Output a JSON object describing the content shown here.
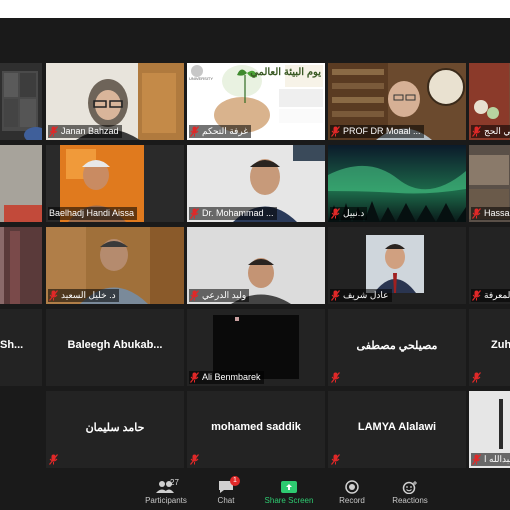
{
  "colors": {
    "active_speaker": "#c9e830",
    "share_green": "#2ecc71",
    "muted_red": "#e02828",
    "tile_bg": "#232323"
  },
  "tiles": {
    "r1c1": {
      "name": ""
    },
    "r1c2": {
      "name": "Janan Bahzad"
    },
    "r1c3": {
      "name": "غرفة التحكم",
      "poster_title": "يوم البيئة العالمي",
      "poster_subtitle": "UNIVERSITY"
    },
    "r1c4": {
      "name": "PROF DR Moaal ..."
    },
    "r1c5": {
      "name": "علي الحج"
    },
    "r2c1": {
      "name": ""
    },
    "r2c2": {
      "name": "Baelhadj Handi Aissa"
    },
    "r2c3": {
      "name": "Dr. Mohammad ..."
    },
    "r2c4": {
      "name": "د.نبيل"
    },
    "r2c5": {
      "name": "Hassan"
    },
    "r3c1": {
      "name": ""
    },
    "r3c2": {
      "name": "د. خليل السعيد"
    },
    "r3c3": {
      "name": "وليد الدرعي"
    },
    "r3c4": {
      "name": "عادل شريف"
    },
    "r3c5": {
      "name": "المعرفة"
    },
    "r4c1": {
      "center": "Sh..."
    },
    "r4c2": {
      "center": "Baleegh  Abukab..."
    },
    "r4c3": {
      "name": "Ali Benmbarek"
    },
    "r4c4": {
      "center": "مصيلحي مصطفى"
    },
    "r4c5": {
      "center": "Zuh..."
    },
    "r5c2": {
      "center": "حامد سليمان"
    },
    "r5c3": {
      "center": "mohamed saddik"
    },
    "r5c4": {
      "center": "LAMYA Alalawi"
    },
    "r5c5": {
      "name": "عبدالله ا"
    }
  },
  "toolbar": {
    "participants": {
      "label": "Participants",
      "count": "27",
      "icon": "participants-icon"
    },
    "chat": {
      "label": "Chat",
      "badge": "1",
      "icon": "chat-icon"
    },
    "share": {
      "label": "Share Screen",
      "icon": "share-screen-icon"
    },
    "record": {
      "label": "Record",
      "icon": "record-icon"
    },
    "reactions": {
      "label": "Reactions",
      "icon": "reactions-icon"
    }
  }
}
